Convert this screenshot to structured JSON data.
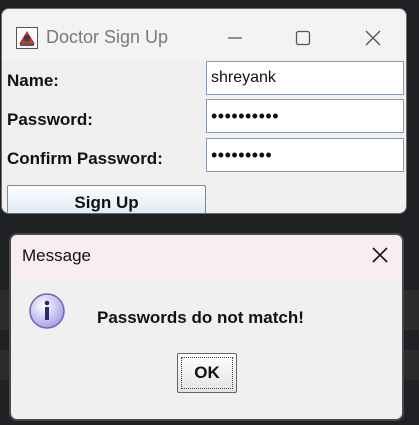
{
  "signup_window": {
    "title": "Doctor Sign Up",
    "form": {
      "name_label": "Name:",
      "name_value": "shreyank",
      "password_label": "Password:",
      "password_value": "••••••••••",
      "confirm_label": "Confirm Password:",
      "confirm_value": "•••••••••"
    },
    "signup_label": "Sign Up"
  },
  "message_dialog": {
    "title": "Message",
    "message": "Passwords do not match!",
    "ok_label": "OK"
  }
}
